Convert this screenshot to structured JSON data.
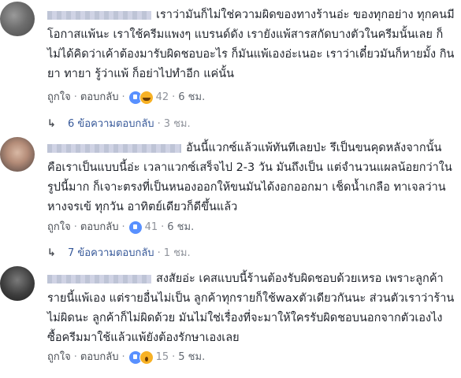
{
  "comments": [
    {
      "text": "เราว่ามันก็ไม่ใช่ความผิดของทางร้านอ่ะ ของทุกอย่าง ทุกคนมีโอกาสแพ้นะ เราใช้ครีมแพงๆ แบรนด์ดัง เรายังแพ้สารสกัดบางตัวในครีมนั้นเลย ก็ไม่ได้คิดว่าเค้าต้องมารับผิดชอบอะไร ก็มันแพ้เองอ่ะเนอะ เราว่าเดี๋ยวมันก็หายมั้ง กินยา ทายา รู้ว่าแพ้ ก็อย่าไปทำอีก แค่นั้น",
      "like": "ถูกใจ",
      "reply": "ตอบกลับ",
      "reactions": [
        "like-icon",
        "laugh-icon"
      ],
      "reaction_count": "42",
      "time": "6 ชม.",
      "replies_label": "6 ข้อความตอบกลับ",
      "replies_time": "3 ชม."
    },
    {
      "text": "อันนี้แวกซ์แล้วแพ้ทันทีเลยป่ะ รึเป็นขนคุดหลังจากนั้น คือเราเป็นแบบนี้อ่ะ เวลาแวกซ์เสร็จไป 2-3 วัน มันถึงเป็น แต่จำนวนแผลน้อยกว่าในรูปนี้มาก ก็เจาะตรงที่เป็นหนองออกให้ขนมันได้งอกออกมา เช็ดน้ำเกลือ ทาเจลว่านหางจรเข้ ทุกวัน อาทิตย์เดียวก็ดีขึ้นแล้ว",
      "like": "ถูกใจ",
      "reply": "ตอบกลับ",
      "reactions": [
        "like-icon"
      ],
      "reaction_count": "41",
      "time": "6 ชม.",
      "replies_label": "7 ข้อความตอบกลับ",
      "replies_time": "1 ชม."
    },
    {
      "text": "สงสัยอ่ะ เคสแบบนี้ร้านต้องรับผิดชอบด้วยเหรอ เพราะลูกค้ารายนี้แพ้เอง แต่รายอื่นไม่เป็น ลูกค้าทุกรายก็ใช้waxตัวเดียวกันนะ ส่วนตัวเราว่าร้านไม่ผิดนะ ลูกค้าก็ไม่ผิดด้วย มันไม่ใช่เรื่องที่จะมาให้ใครรับผิดชอบนอกจากตัวเองไง ซื้อครีมมาใช้แล้วแพ้ยังต้องรักษาเองเลย",
      "like": "ถูกใจ",
      "reply": "ตอบกลับ",
      "reactions": [
        "like-icon",
        "wow-icon"
      ],
      "reaction_count": "15",
      "time": "5 ชม."
    }
  ],
  "colors": {
    "link": "#365899",
    "meta": "#90949c",
    "text": "#1d2129",
    "like": "#5890ff",
    "emoji": "#f7b125"
  }
}
